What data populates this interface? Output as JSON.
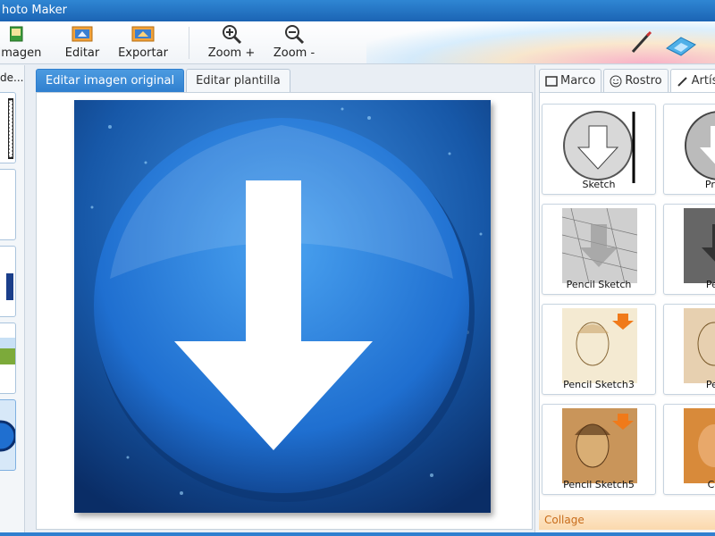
{
  "window": {
    "title": "hoto Maker"
  },
  "toolbar": {
    "image_label": "imagen",
    "edit_label": "Editar",
    "export_label": "Exportar",
    "zoom_in_label": "Zoom +",
    "zoom_out_label": "Zoom -"
  },
  "left_panel": {
    "header": "de..."
  },
  "editor": {
    "tabs": [
      {
        "label": "Editar imagen original",
        "active": true
      },
      {
        "label": "Editar plantilla",
        "active": false
      }
    ]
  },
  "right_panel": {
    "tabs": [
      {
        "label": "Marco",
        "icon": "frame-icon"
      },
      {
        "label": "Rostro",
        "icon": "smiley-icon"
      },
      {
        "label": "Artís",
        "icon": "brush-icon",
        "active": true
      }
    ],
    "effects": [
      {
        "label": "Sketch"
      },
      {
        "label": "Profile"
      },
      {
        "label": "Pencil Sketch"
      },
      {
        "label": "Pencil"
      },
      {
        "label": "Pencil Sketch3"
      },
      {
        "label": "Pencil"
      },
      {
        "label": "Pencil Sketch5"
      },
      {
        "label": "Color"
      }
    ],
    "section": "Collage"
  },
  "colors": {
    "accent": "#2f7fcf",
    "title_bar": "#1b64b4",
    "artwork_blue": "#1f6fd0"
  }
}
